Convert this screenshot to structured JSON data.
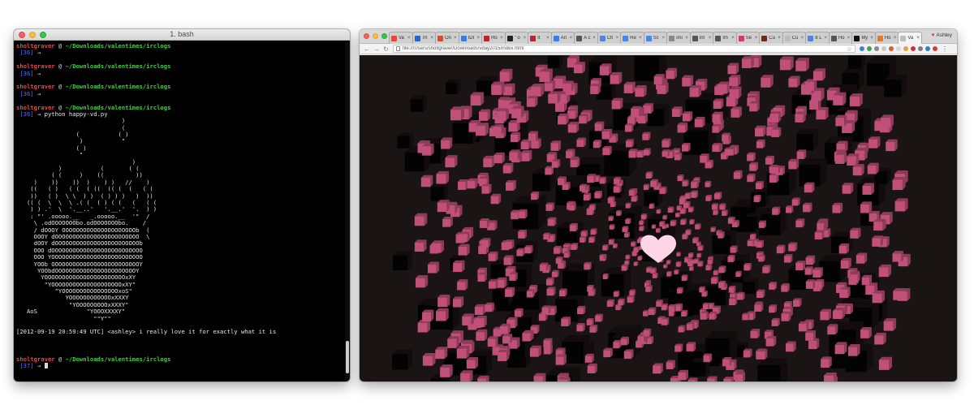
{
  "terminal": {
    "title": "1. bash",
    "user": "sholtgraver",
    "at": "@",
    "path": "~/Downloads/valentimes/irclogs",
    "arrow": "→",
    "prompts": [
      {
        "num": "[36]",
        "command": ""
      },
      {
        "num": "[36]",
        "command": ""
      },
      {
        "num": "[36]",
        "command": ""
      },
      {
        "num": "[36]",
        "command": "python happy-vd.py"
      }
    ],
    "art": [
      "                              )",
      "                              (",
      "                 (           ( )",
      "                  )           \"",
      "                 ( )",
      "                  \"",
      "                                 )",
      "            )           (       ( (",
      "          ( (     )    ((         ))",
      "     )    ))    ))  )    ) )   //    )",
      "    ((   ( )   ( (  ( ((  (( (  (   ( (",
      "    ))   ( )  \\ \\  ) )  ( ) ) )   )  ))",
      "   (( (  \\  \\  \\ .( (  ( ) ( (   (   ( (",
      "    ) ) .'  \\  '.__..'   '.__.'  '.  ) )",
      "    : \"' .ooooo.__   _.ooooo.__  '\"  /",
      "     \\ .odOOOOOOObo.odOOOOOOObo.    /",
      "     / dOOOY OOOOOOOOOOOOOOOOOOOOOb  (",
      "     OOOY dOOOOOOOOOOOOOOOOOOOOOOOO  \\",
      "     dOOY dOOOOOOOOOOOOOOOOOOOOOOOOb",
      "     OOO dOOOOOOOOOOOOOOOOOOOOOOOOOO",
      "     OOO YOOOOOOOOOOOOOOOOOOOOOOOOOO",
      "     YOOb OOOOOOOOOOOOOOOOOOOOOOOOOY",
      "      YOObdOOOOOOOOOOOOOOOOOOOOOOOY",
      "       YOOOOOOOOOOOOOOOOOOOOOOOxXY",
      "        \"YOOOOOOOOOOOOOOOOOOOOxXY\"",
      "           \"YOOOOOOOOOOOOOOOOxoS\"",
      "              YOOOOOOOOOOOOxXXXY",
      "               \"YOOOOOOOOOxXXXY\"",
      "   AoS              \"YOOOXXXXY\"",
      "                      \"\"Y\"\""
    ],
    "log_line": "[2012-09-19 20:59:49 UTC] <ashley> i really love it for exactly what it is",
    "last_num": "[37]"
  },
  "browser": {
    "profile_name": "Ashley",
    "url": "file:///Users/sholtgraver/Downloads/vday2015/index.html",
    "tabs": [
      {
        "label": "Va",
        "color": "#e04a3a"
      },
      {
        "label": "Th",
        "color": "#2a62c9"
      },
      {
        "label": "On",
        "color": "#d84a2e"
      },
      {
        "label": "IDI",
        "color": "#3c7bd9"
      },
      {
        "label": "Ho",
        "color": "#b8262b"
      },
      {
        "label": "\" o",
        "color": "#222222"
      },
      {
        "label": "It",
        "color": "#b8262b"
      },
      {
        "label": "An",
        "color": "#3f7be0"
      },
      {
        "label": "A c",
        "color": "#555555"
      },
      {
        "label": "Ch",
        "color": "#4a86e8"
      },
      {
        "label": "Re",
        "color": "#4a86e8"
      },
      {
        "label": "Sc",
        "color": "#4a86e8"
      },
      {
        "label": "imi",
        "color": "#888888"
      },
      {
        "label": "Im",
        "color": "#555555"
      },
      {
        "label": "Im",
        "color": "#555555"
      },
      {
        "label": "Se",
        "color": "#d23a6c"
      },
      {
        "label": "Cu",
        "color": "#6b2c1c"
      },
      {
        "label": "Cu",
        "color": "#bdbdbd"
      },
      {
        "label": "8 L",
        "color": "#4a86e8"
      },
      {
        "label": "Ho",
        "color": "#555555"
      },
      {
        "label": "My",
        "color": "#111111"
      },
      {
        "label": "Ho",
        "color": "#e07b2a"
      },
      {
        "label": "Va",
        "color": "#bdbdbd"
      }
    ],
    "active_tab": 22,
    "extension_colors": [
      "#3b82d6",
      "#3ba54a",
      "#8a8a8a",
      "#c9c9c9",
      "#e05a2a",
      "#d6d6d6",
      "#e8a13a",
      "#cc3333",
      "#7c7c7c",
      "#3a7bd5",
      "#d83a3a"
    ]
  },
  "scene": {
    "background": "#1b1414",
    "cube_color": "#c0507a",
    "cube_side_color": "#8f3b5a",
    "dark_cube_color": "#030303",
    "heart_color": "#ffd6e8"
  }
}
